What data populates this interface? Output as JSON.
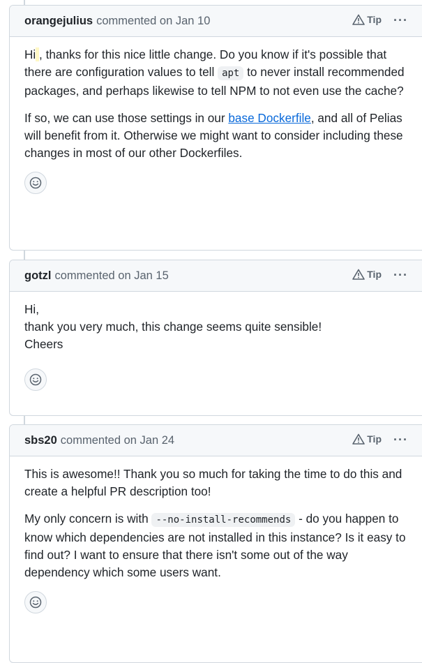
{
  "comments": [
    {
      "author": "orangejulius",
      "action": "commented on Jan 10",
      "tip": "Tip",
      "more": "···",
      "p1_a": "Hi",
      "p1_mention": " ",
      "p1_b": ", thanks for this nice little change. Do you know if it's possible that there are configuration values to tell ",
      "p1_code": "apt",
      "p1_c": " to never install recommended packages, and perhaps likewise to tell NPM to not even use the cache?",
      "p2_a": "If so, we can use those settings in our ",
      "p2_link": "base Dockerfile",
      "p2_b": ", and all of Pelias will benefit from it. Otherwise we might want to consider including these changes in most of our other Dockerfiles."
    },
    {
      "author": "gotzl",
      "action": "commented on Jan 15",
      "tip": "Tip",
      "more": "···",
      "line1": "Hi,",
      "line2": "thank you very much, this change seems quite sensible!",
      "line3": "Cheers"
    },
    {
      "author": "sbs20",
      "action": "commented on Jan 24",
      "tip": "Tip",
      "more": "···",
      "p1": "This is awesome!! Thank you so much for taking the time to do this and create a helpful PR description too!",
      "p2_a": "My only concern is with ",
      "p2_code": "--no-install-recommends",
      "p2_b": " - do you happen to know which dependencies are not installed in this instance? Is it easy to find out? I want to ensure that there isn't some out of the way dependency which some users want."
    }
  ],
  "icons": {
    "tip": "alert-triangle-icon",
    "more": "kebab-horizontal-icon",
    "reaction": "smiley-icon"
  },
  "colors": {
    "link": "#0969da",
    "header_bg": "#f6f8fa",
    "border": "#d0d7de",
    "muted": "#59636e",
    "mention_highlight": "#fff8c5"
  }
}
